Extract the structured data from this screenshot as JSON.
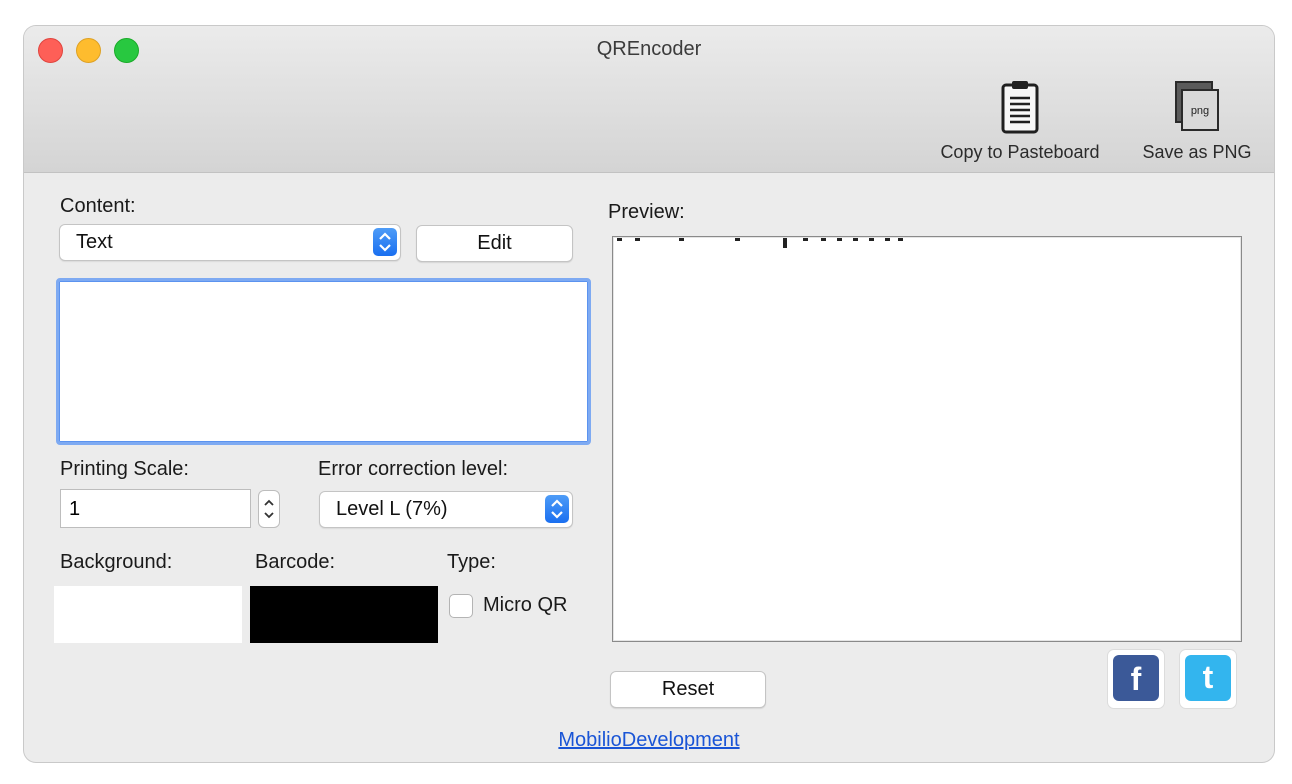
{
  "window": {
    "title": "QREncoder"
  },
  "toolbar": {
    "copy_label": "Copy to Pasteboard",
    "save_label": "Save as PNG",
    "png_badge": "png"
  },
  "content": {
    "label": "Content:",
    "type_selected": "Text",
    "edit_label": "Edit",
    "text_value": ""
  },
  "printing_scale": {
    "label": "Printing Scale:",
    "value": "1"
  },
  "error_correction": {
    "label": "Error correction level:",
    "selected": "Level L (7%)"
  },
  "colors": {
    "background_label": "Background:",
    "barcode_label": "Barcode:",
    "background_color": "#ffffff",
    "barcode_color": "#000000"
  },
  "type": {
    "label": "Type:",
    "micro_qr_label": "Micro QR",
    "micro_qr_checked": false
  },
  "preview": {
    "label": "Preview:"
  },
  "reset_label": "Reset",
  "social": {
    "facebook_glyph": "f",
    "twitter_glyph": "t"
  },
  "footer_link": "MobilioDevelopment",
  "accent_color": "#1a6ff0"
}
